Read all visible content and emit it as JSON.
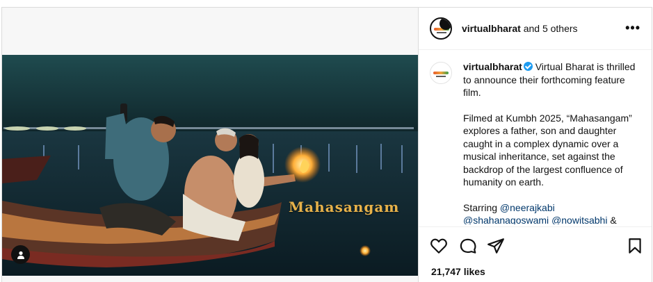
{
  "post": {
    "film_title": "Mahasangam",
    "tag_icon": "user-tag-icon"
  },
  "header": {
    "username": "virtualbharat",
    "collab_text": "and 5 others",
    "more_icon": "more-horizontal-icon"
  },
  "caption": {
    "username": "virtualbharat",
    "intro": "Virtual Bharat is thrilled to announce their forthcoming feature film.",
    "body": "Filmed at Kumbh 2025, “Mahasangam” explores a father, son and daughter caught in a complex dynamic over a musical inheritance, set against the backdrop of the largest confluence of humanity on earth.",
    "starring_label": "Starring",
    "mentions": [
      "@neerajkabi",
      "@shahanagoswami",
      "@nowitsabhi"
    ],
    "trailing": "&"
  },
  "actions": {
    "icons": [
      "heart-icon",
      "comment-icon",
      "share-icon",
      "bookmark-icon"
    ],
    "likes": "21,747 likes"
  },
  "colors": {
    "link": "#00376b",
    "verified": "#1d9bf0",
    "title_gold": "#e7b24a"
  }
}
